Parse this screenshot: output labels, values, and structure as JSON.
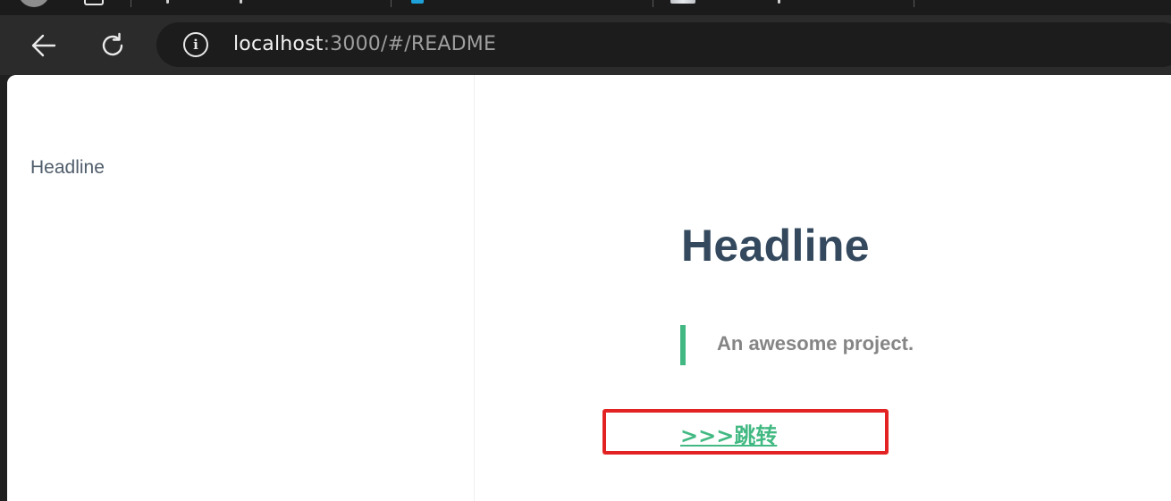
{
  "browser": {
    "url_host": "localhost",
    "url_path": ":3000/#/README"
  },
  "sidebar": {
    "items": [
      {
        "label": "Headline"
      }
    ]
  },
  "main": {
    "title": "Headline",
    "blockquote": "An awesome project.",
    "link_label": ">>>跳转"
  },
  "colors": {
    "accent": "#42b983",
    "heading": "#34495e",
    "annotation": "#e32323"
  }
}
